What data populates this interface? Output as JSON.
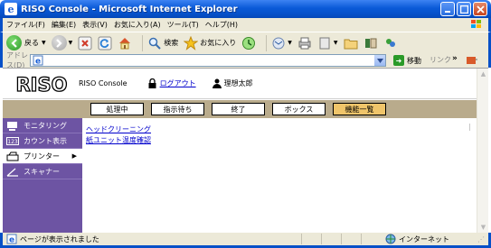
{
  "window": {
    "title": "RISO Console - Microsoft Internet Explorer"
  },
  "menu": [
    "ファイル(F)",
    "編集(E)",
    "表示(V)",
    "お気に入り(A)",
    "ツール(T)",
    "ヘルプ(H)"
  ],
  "toolbar": {
    "back_label": "戻る",
    "search_label": "検索",
    "favorites_label": "お気に入り"
  },
  "address": {
    "label": "アドレス(D)",
    "value": "",
    "go_label": "移動",
    "links_label": "リンク"
  },
  "riso": {
    "logo_text": "RISO",
    "console_label": "RISO Console",
    "logout_label": "ログアウト",
    "user_name": "理想太郎"
  },
  "tabs": [
    {
      "label": "処理中"
    },
    {
      "label": "指示待ち"
    },
    {
      "label": "終了"
    },
    {
      "label": "ボックス"
    },
    {
      "label": "機能一覧"
    }
  ],
  "sidebar": {
    "items": [
      {
        "label": "モニタリング"
      },
      {
        "label": "カウント表示"
      },
      {
        "label": "プリンター"
      },
      {
        "label": "スキャナー"
      }
    ]
  },
  "main": {
    "links": [
      "ヘッドクリーニング",
      "紙ユニット温度確認"
    ]
  },
  "status": {
    "text": "ページが表示されました",
    "zone": "インターネット"
  },
  "colors": {
    "titlebar": "#0650c8",
    "tabbar": "#b9ab8c",
    "active_tab": "#f0c56a",
    "sidebar": "#6d54a3",
    "link": "#0000cc"
  }
}
